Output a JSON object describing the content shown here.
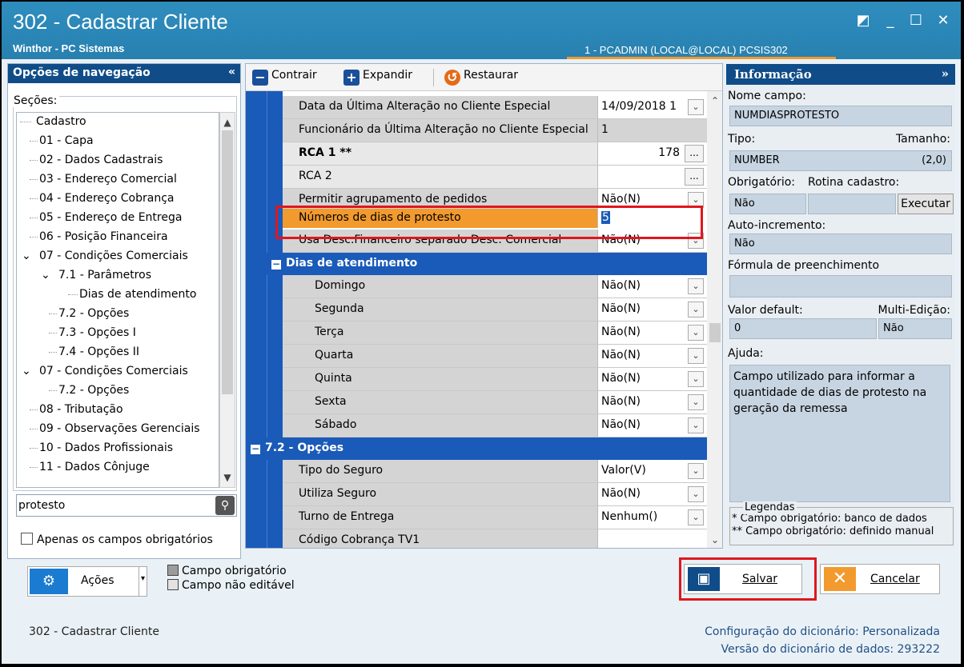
{
  "window": {
    "title": "302 - Cadastrar Cliente",
    "subtitle": "Winthor - PC Sistemas",
    "user_info": "1 - PCADMIN (LOCAL@LOCAL)   PCSIS302",
    "buttons": {
      "restore": "◩",
      "minimize": "_",
      "maximize": "☐",
      "close": "✕"
    }
  },
  "nav": {
    "header": "Opções de navegação",
    "collapse": "«",
    "sections_label": "Seções:",
    "tree": [
      "Cadastro",
      "01 - Capa",
      "02 - Dados Cadastrais",
      "03 - Endereço Comercial",
      "04 - Endereço Cobrança",
      "05 - Endereço de Entrega",
      "06 - Posição Financeira",
      "07 - Condições Comerciais",
      "7.1 - Parâmetros",
      "Dias de atendimento",
      "7.2 - Opções",
      "7.3 - Opções I",
      "7.4 - Opções II",
      "07 - Condições Comerciais",
      "7.2 - Opções",
      "08 - Tributação",
      "09 - Observações Gerenciais",
      "10 - Dados Profissionais",
      "11 - Dados Cônjuge"
    ],
    "search_value": "protesto",
    "only_required_label": "Apenas os campos obrigatórios"
  },
  "toolbar": {
    "collapse_label": "Contrair",
    "expand_label": "Expandir",
    "restore_label": "Restaurar"
  },
  "grid": {
    "rows": [
      {
        "name": "Data da Última Alteração no Cliente Especial",
        "value": "14/09/2018 1"
      },
      {
        "name": "Funcionário da Última Alteração no Cliente Especial",
        "value": "1"
      },
      {
        "name": "RCA 1 **",
        "value": "178"
      },
      {
        "name": "RCA 2",
        "value": ""
      },
      {
        "name": "Permitir agrupamento de pedidos",
        "value": "Não(N)"
      },
      {
        "name": "Números de dias de protesto",
        "value": "5"
      },
      {
        "name": "Usa Desc.Financeiro separado Desc. Comercial",
        "value": "Não(N)"
      }
    ],
    "section_days": "Dias de atendimento",
    "days": [
      {
        "name": "Domingo",
        "value": "Não(N)"
      },
      {
        "name": "Segunda",
        "value": "Não(N)"
      },
      {
        "name": "Terça",
        "value": "Não(N)"
      },
      {
        "name": "Quarta",
        "value": "Não(N)"
      },
      {
        "name": "Quinta",
        "value": "Não(N)"
      },
      {
        "name": "Sexta",
        "value": "Não(N)"
      },
      {
        "name": "Sábado",
        "value": "Não(N)"
      }
    ],
    "section_options": "7.2 - Opções",
    "options": [
      {
        "name": "Tipo do Seguro",
        "value": "Valor(V)"
      },
      {
        "name": "Utiliza Seguro",
        "value": "Não(N)"
      },
      {
        "name": "Turno de Entrega",
        "value": "Nenhum()"
      },
      {
        "name": "Código Cobrança TV1",
        "value": ""
      }
    ]
  },
  "info": {
    "header": "Informação",
    "collapse": "»",
    "field_name_label": "Nome campo:",
    "field_name": "NUMDIASPROTESTO",
    "type_label": "Tipo:",
    "size_label": "Tamanho:",
    "type": "NUMBER",
    "size": "(2,0)",
    "required_label": "Obrigatório:",
    "routine_label": "Rotina cadastro:",
    "required": "Não",
    "execute_label": "Executar",
    "autoinc_label": "Auto-incremento:",
    "autoinc": "Não",
    "formula_label": "Fórmula de preenchimento",
    "formula": "",
    "default_label": "Valor default:",
    "multi_label": "Multi-Edição:",
    "default": "0",
    "multi": "Não",
    "help_label": "Ajuda:",
    "help": "Campo utilizado para informar a quantidade de dias de protesto na geração da remessa",
    "legend_title": "Legendas",
    "legend1": "* Campo obrigatório: banco de dados",
    "legend2": "** Campo obrigatório: definido manual"
  },
  "bottom": {
    "actions_label": "Ações",
    "legend_required": "Campo obrigatório",
    "legend_readonly": "Campo não editável",
    "save_label": "Salvar",
    "cancel_label": "Cancelar",
    "status_left": "302 - Cadastrar Cliente",
    "config_label": "Configuração do dicionário:",
    "config_value": "Personalizada",
    "version_label": "Versão do dicionário de dados:",
    "version_value": "293222"
  },
  "colors": {
    "title_bar": "#2a86b6",
    "nav_header": "#0f4c88",
    "grid_blue": "#1a5ab8",
    "highlight_orange": "#f29a2e",
    "annotation_red": "#e0161e"
  }
}
